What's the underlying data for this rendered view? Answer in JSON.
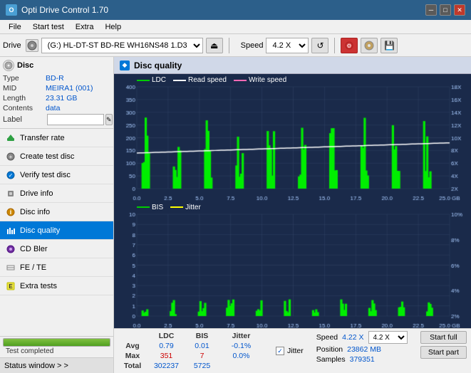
{
  "app": {
    "title": "Opti Drive Control 1.70",
    "icon_label": "O"
  },
  "menu": {
    "items": [
      "File",
      "Start test",
      "Extra",
      "Help"
    ]
  },
  "toolbar": {
    "drive_label": "Drive",
    "drive_value": "(G:)  HL-DT-ST BD-RE  WH16NS48 1.D3",
    "speed_label": "Speed",
    "speed_value": "4.2 X"
  },
  "disc": {
    "header": "Disc",
    "type_label": "Type",
    "type_value": "BD-R",
    "mid_label": "MID",
    "mid_value": "MEIRA1 (001)",
    "length_label": "Length",
    "length_value": "23.31 GB",
    "contents_label": "Contents",
    "contents_value": "data",
    "label_label": "Label"
  },
  "nav": {
    "items": [
      {
        "label": "Transfer rate",
        "icon": "transfer-icon"
      },
      {
        "label": "Create test disc",
        "icon": "create-icon"
      },
      {
        "label": "Verify test disc",
        "icon": "verify-icon"
      },
      {
        "label": "Drive info",
        "icon": "drive-icon"
      },
      {
        "label": "Disc info",
        "icon": "disc-icon"
      },
      {
        "label": "Disc quality",
        "icon": "quality-icon",
        "active": true
      },
      {
        "label": "CD Bler",
        "icon": "bler-icon"
      },
      {
        "label": "FE / TE",
        "icon": "fete-icon"
      },
      {
        "label": "Extra tests",
        "icon": "extra-icon"
      }
    ]
  },
  "status": {
    "window_label": "Status window > >",
    "progress": 100,
    "status_text": "Test completed"
  },
  "disc_quality": {
    "title": "Disc quality",
    "chart1": {
      "legend": [
        {
          "label": "LDC",
          "color": "#00cc00"
        },
        {
          "label": "Read speed",
          "color": "#ffffff"
        },
        {
          "label": "Write speed",
          "color": "#ff69b4"
        }
      ],
      "y_axis_left": [
        "400",
        "350",
        "300",
        "250",
        "200",
        "150",
        "100",
        "50",
        "0"
      ],
      "y_axis_right": [
        "18X",
        "16X",
        "14X",
        "12X",
        "10X",
        "8X",
        "6X",
        "4X",
        "2X"
      ],
      "x_axis": [
        "0.0",
        "2.5",
        "5.0",
        "7.5",
        "10.0",
        "12.5",
        "15.0",
        "17.5",
        "20.0",
        "22.5",
        "25.0 GB"
      ]
    },
    "chart2": {
      "legend": [
        {
          "label": "BIS",
          "color": "#00cc00"
        },
        {
          "label": "Jitter",
          "color": "#ffff00"
        }
      ],
      "y_axis_left": [
        "10",
        "9",
        "8",
        "7",
        "6",
        "5",
        "4",
        "3",
        "2",
        "1",
        "0"
      ],
      "y_axis_right": [
        "10%",
        "8%",
        "6%",
        "4%",
        "2%"
      ],
      "x_axis": [
        "0.0",
        "2.5",
        "5.0",
        "7.5",
        "10.0",
        "12.5",
        "15.0",
        "17.5",
        "20.0",
        "22.5",
        "25.0 GB"
      ]
    }
  },
  "stats": {
    "headers": [
      "",
      "LDC",
      "BIS",
      "Jitter"
    ],
    "avg": {
      "label": "Avg",
      "ldc": "0.79",
      "bis": "0.01",
      "jitter": "-0.1%"
    },
    "max": {
      "label": "Max",
      "ldc": "351",
      "bis": "7",
      "jitter": "0.0%"
    },
    "total": {
      "label": "Total",
      "ldc": "302237",
      "bis": "5725",
      "jitter": ""
    },
    "speed_label": "Speed",
    "speed_value": "4.22 X",
    "speed_select": "4.2 X",
    "position_label": "Position",
    "position_value": "23862 MB",
    "samples_label": "Samples",
    "samples_value": "379351",
    "btn_full": "Start full",
    "btn_part": "Start part"
  }
}
